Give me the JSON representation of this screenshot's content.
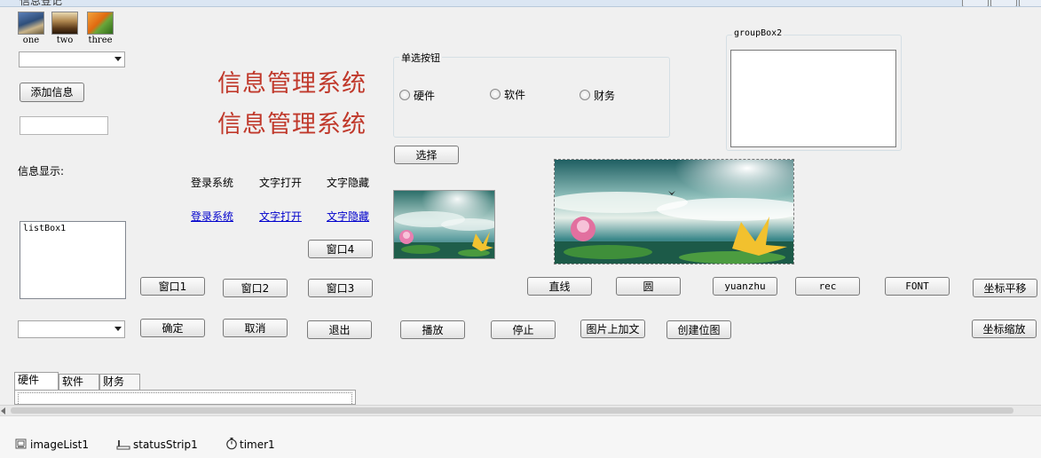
{
  "window": {
    "title": "信息登记"
  },
  "image_list": [
    {
      "label": "one"
    },
    {
      "label": "two"
    },
    {
      "label": "three"
    }
  ],
  "buttons": {
    "add_info": "添加信息",
    "select": "选择",
    "window1": "窗口1",
    "window2": "窗口2",
    "window3": "窗口3",
    "window4": "窗口4",
    "ok": "确定",
    "cancel": "取消",
    "exit": "退出",
    "play": "播放",
    "stop": "停止",
    "text_on_image": "图片上加文",
    "create_bitmap": "创建位图",
    "line": "直线",
    "circle": "圆",
    "yuanzhu": "yuanzhu",
    "rec": "rec",
    "font": "FONT",
    "coord_translate": "坐标平移",
    "coord_scale": "坐标缩放"
  },
  "titles": {
    "line1": "信息管理系统",
    "line2": "信息管理系统"
  },
  "labels": {
    "info_display": "信息显示:",
    "login_system": "登录系统",
    "text_open": "文字打开",
    "text_hide": "文字隐藏"
  },
  "links": {
    "login_system": "登录系统",
    "text_open": "文字打开",
    "text_hide": "文字隐藏"
  },
  "radio_group": {
    "title": "单选按钮",
    "options": [
      "硬件",
      "软件",
      "财务"
    ]
  },
  "group_box2": {
    "title": "groupBox2"
  },
  "listbox": {
    "text": "listBox1"
  },
  "tabs": [
    "硬件",
    "软件",
    "财务"
  ],
  "tray": {
    "image_list": "imageList1",
    "status_strip": "statusStrip1",
    "timer": "timer1"
  },
  "colors": {
    "title_red": "#c0392b",
    "link_blue": "#0000cc"
  }
}
